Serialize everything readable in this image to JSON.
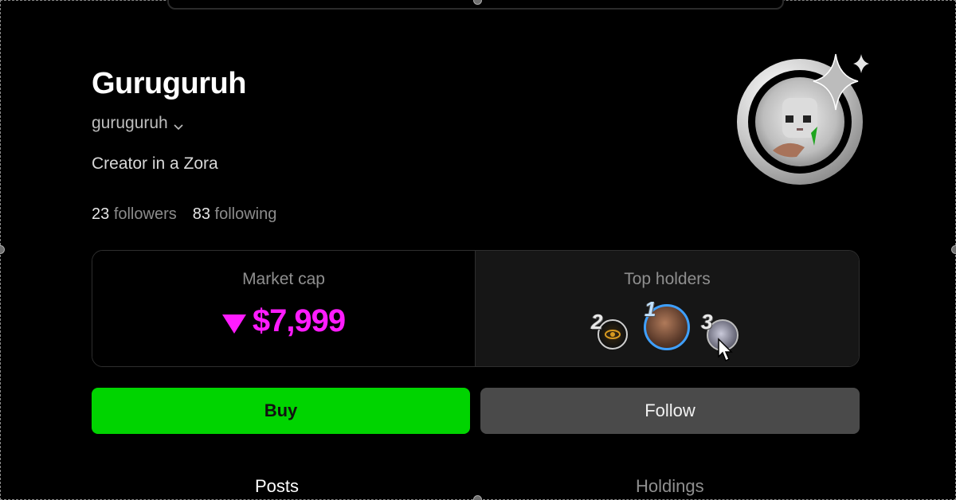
{
  "profile": {
    "display_name": "Guruguruh",
    "username": "guruguruh",
    "bio": "Creator in a Zora",
    "followers_count": "23",
    "followers_label": "followers",
    "following_count": "83",
    "following_label": "following"
  },
  "market": {
    "label": "Market cap",
    "value": "$7,999",
    "trend": "down",
    "color": "#ff1cff"
  },
  "top_holders": {
    "label": "Top holders",
    "holders": [
      {
        "rank": "2"
      },
      {
        "rank": "1"
      },
      {
        "rank": "3"
      }
    ]
  },
  "actions": {
    "buy_label": "Buy",
    "follow_label": "Follow",
    "buy_color": "#00d400"
  },
  "tabs": [
    {
      "label": "Posts",
      "active": true
    },
    {
      "label": "Holdings",
      "active": false
    }
  ],
  "icons": [
    "chevron-down-icon",
    "sparkle-icon",
    "triangle-down-icon",
    "cursor-pointer-icon"
  ]
}
